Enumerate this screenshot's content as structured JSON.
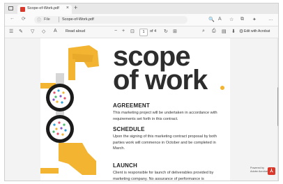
{
  "browser": {
    "tab_title": "Scope-of-Work.pdf",
    "tab_close": "×",
    "new_tab": "+",
    "url_label": "File",
    "url_text": "Scope-of-Work.pdf"
  },
  "pdf_toolbar": {
    "read_aloud": "Read aloud",
    "zoom_out": "−",
    "zoom_in": "+",
    "page_current": "1",
    "page_of": "of 4",
    "edit_with_acrobat": "Edit with Acrobat"
  },
  "document": {
    "title_line1": "scope",
    "title_line2": "of work",
    "accent_color": "#f2b431",
    "sections": [
      {
        "heading": "AGREEMENT",
        "body": "This marketing project will be undertaken in accordance with requirements set forth in this contract."
      },
      {
        "heading": "SCHEDULE",
        "body": "Upon the signing of this marketing contract proposal by both parties work will commence in October and be completed in March."
      },
      {
        "heading": "LAUNCH",
        "body": "Client is responsible for launch of deliverables provided by marketing company. No assurance of performance is"
      }
    ]
  },
  "badge": {
    "line1": "Powered by",
    "line2": "Adobe Acrobat"
  },
  "icons": [
    "window-icon",
    "pdf-icon",
    "back-icon",
    "refresh-icon",
    "info-icon",
    "zoom-icon",
    "read-mode-icon",
    "favorite-icon",
    "collections-icon",
    "extensions-icon",
    "menu-icon",
    "contents-icon",
    "draw-icon",
    "highlight-icon",
    "erase-icon",
    "fit-page-icon",
    "rotate-icon",
    "search-icon",
    "print-icon",
    "save-icon",
    "settings-icon"
  ]
}
